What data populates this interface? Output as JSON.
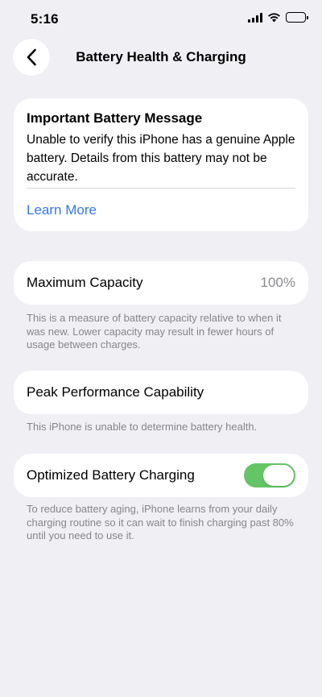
{
  "status_bar": {
    "time": "5:16",
    "icons": [
      "cellular-signal-icon",
      "wifi-icon",
      "battery-icon"
    ]
  },
  "nav": {
    "back_icon": "chevron-left-icon",
    "title": "Battery Health & Charging"
  },
  "battery_message": {
    "title": "Important Battery Message",
    "body": "Unable to verify this iPhone has a genuine Apple battery. Details from this battery may not be accurate.",
    "link": "Learn More"
  },
  "maximum_capacity": {
    "label": "Maximum Capacity",
    "value": "100%",
    "footnote": "This is a measure of battery capacity relative to when it was new. Lower capacity may result in fewer hours of usage between charges."
  },
  "peak_performance": {
    "label": "Peak Performance Capability",
    "footnote": "This iPhone is unable to determine battery health."
  },
  "optimized_charging": {
    "label": "Optimized Battery Charging",
    "enabled": true,
    "footnote": "To reduce battery aging, iPhone learns from your daily charging routine so it can wait to finish charging past 80% until you need to use it."
  },
  "colors": {
    "background": "#efeff4",
    "card": "#ffffff",
    "link": "#3478f6",
    "toggle_on": "#65c466",
    "secondary_text": "#86868b"
  }
}
